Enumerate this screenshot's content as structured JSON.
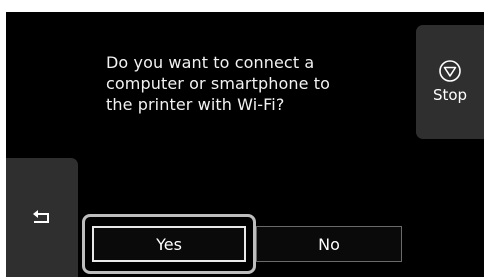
{
  "dialog": {
    "question": "Do you want to connect a\ncomputer or smartphone to\nthe printer with Wi-Fi?"
  },
  "stop_button": {
    "label": "Stop",
    "icon": "stop-icon"
  },
  "back_button": {
    "icon": "back-arrow-icon"
  },
  "options": {
    "yes_label": "Yes",
    "no_label": "No",
    "selected": "Yes"
  },
  "colors": {
    "background": "#000000",
    "button_fill": "#2f2f2f",
    "text": "#ffffff",
    "focus_ring": "#bdbdbd"
  }
}
